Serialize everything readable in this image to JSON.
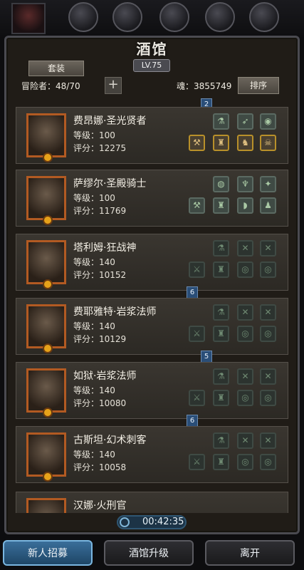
{
  "header": {
    "title": "酒馆",
    "level": "LV.75",
    "outfit_label": "套装",
    "adventurers": "冒险者：48/70",
    "plus_label": "+",
    "soul": "魂：3855749",
    "sort_label": "排序"
  },
  "heroes": [
    {
      "name": "费昂娜·圣光贤者",
      "level": "等级：100",
      "score": "评分：12275",
      "badge": "2"
    },
    {
      "name": "萨缪尔·圣殿骑士",
      "level": "等级：100",
      "score": "评分：11769",
      "badge": ""
    },
    {
      "name": "塔利姆·狂战神",
      "level": "等级：140",
      "score": "评分：10152",
      "badge": ""
    },
    {
      "name": "费耶雅特·岩浆法师",
      "level": "等级：140",
      "score": "评分：10129",
      "badge": "6"
    },
    {
      "name": "如狱·岩浆法师",
      "level": "等级：140",
      "score": "评分：10080",
      "badge": "5"
    },
    {
      "name": "古斯坦·幻术刺客",
      "level": "等级：140",
      "score": "评分：10058",
      "badge": "6"
    },
    {
      "name": "汉娜·火刑官",
      "level": "",
      "score": "",
      "badge": ""
    }
  ],
  "timer": "00:42:35",
  "bottom": {
    "recruit": "新人招募",
    "upgrade": "酒馆升级",
    "leave": "离开"
  },
  "icons": {
    "plus": "plus-icon",
    "timer": "clock-icon",
    "equipment": "equipment-slot-icon"
  }
}
